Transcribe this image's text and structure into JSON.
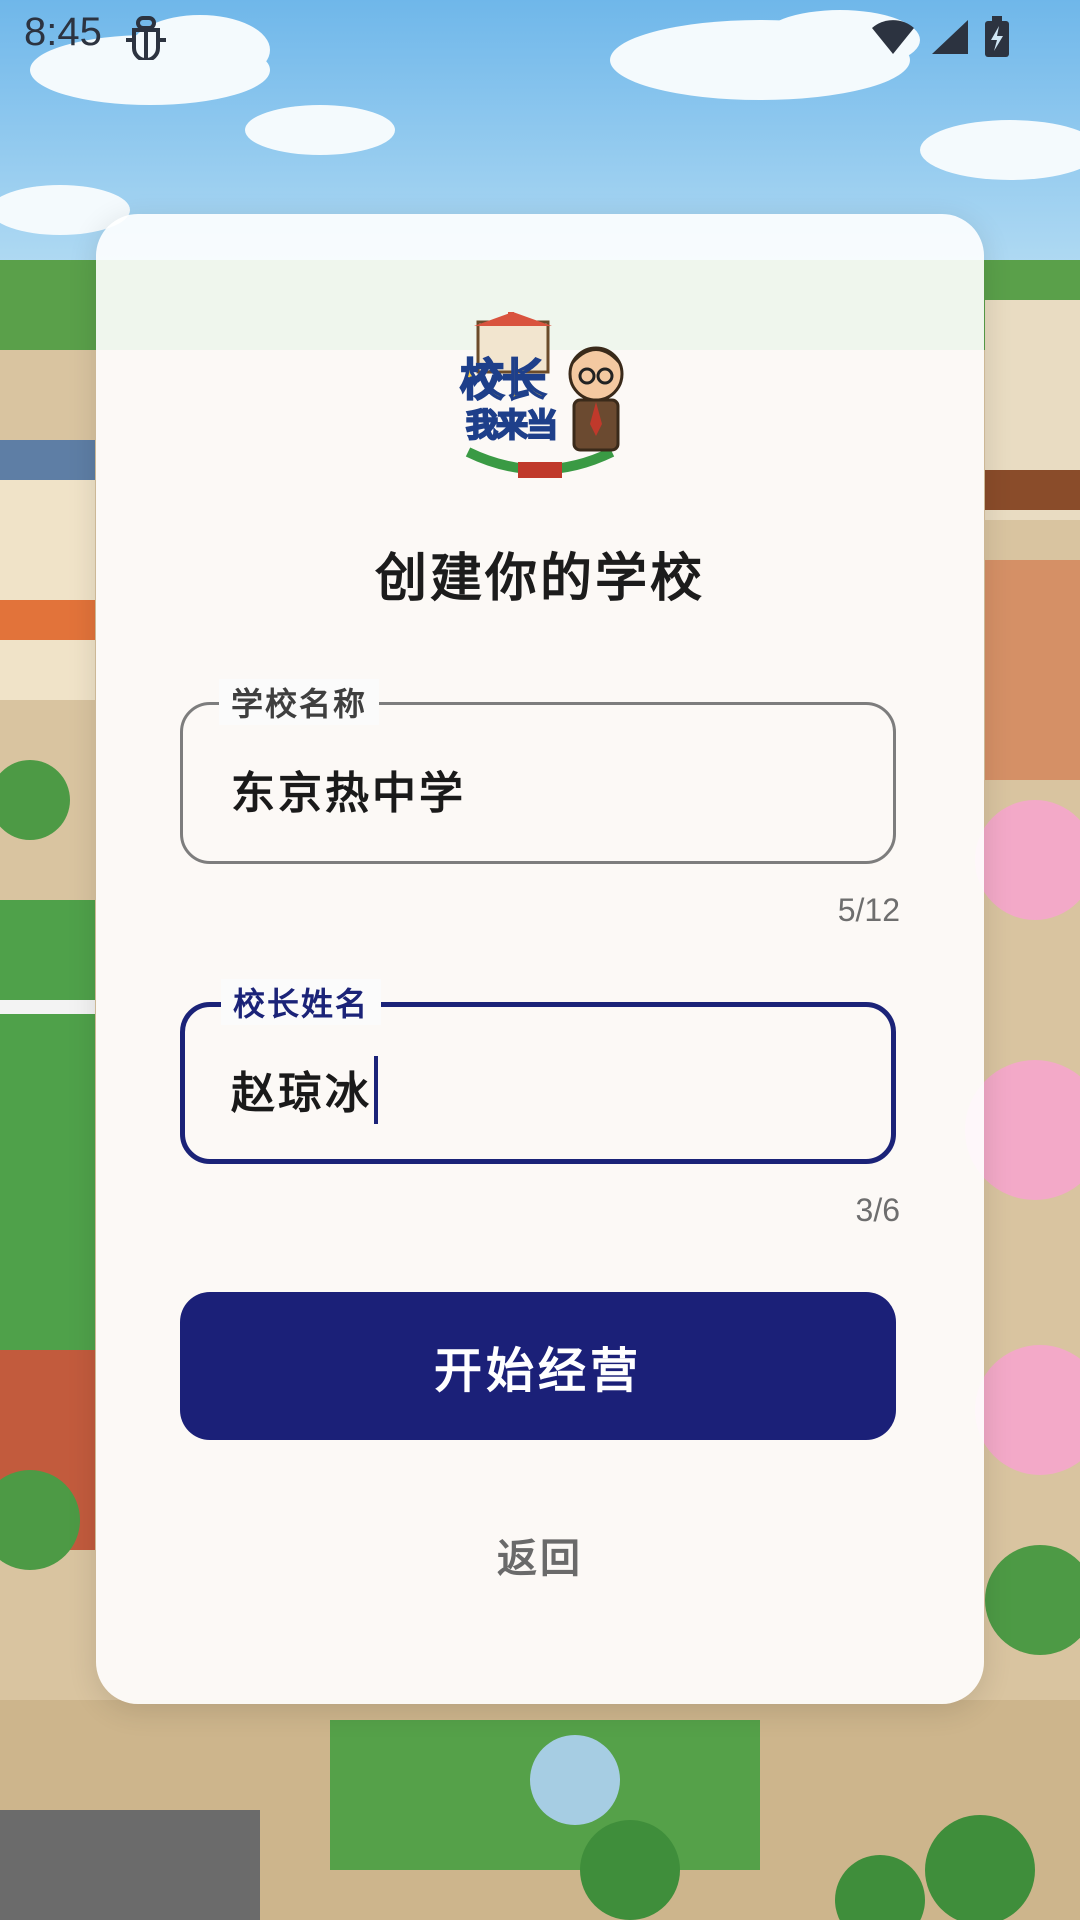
{
  "status_bar": {
    "time": "8:45",
    "icons": [
      "bug-icon",
      "wifi-icon",
      "signal-icon",
      "battery-charging-icon"
    ]
  },
  "app": {
    "logo_text_line1": "校长",
    "logo_text_line2": "我来当",
    "title": "创建你的学校"
  },
  "form": {
    "school_name": {
      "label": "学校名称",
      "value": "东京热中学",
      "counter": "5/12"
    },
    "principal_name": {
      "label": "校长姓名",
      "value": "赵琼冰",
      "counter": "3/6"
    },
    "start_button": "开始经营",
    "back_link": "返回"
  },
  "colors": {
    "accent": "#1b2078",
    "focused_border": "#1b2378",
    "counter_text": "#6e6e6e",
    "sky": "#8cc6ee"
  }
}
